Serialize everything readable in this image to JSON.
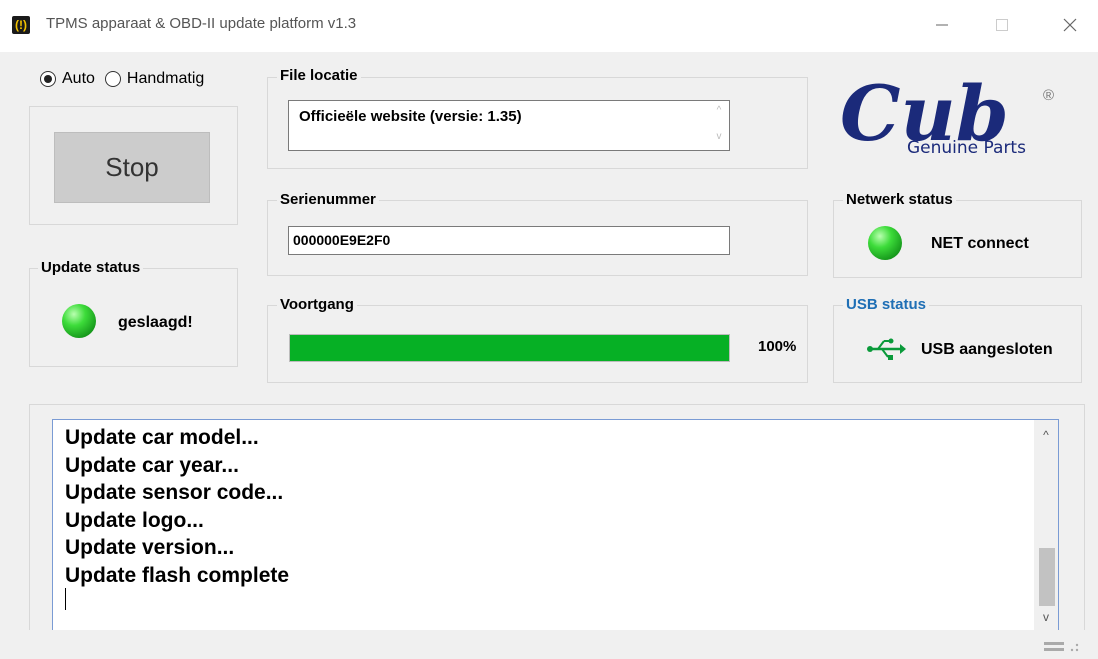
{
  "window": {
    "title": "TPMS apparaat & OBD-II update platform v1.3",
    "icon": "tpms-warning-icon",
    "controls": {
      "minimize": "—",
      "maximize": "☐",
      "close": "✕"
    }
  },
  "mode": {
    "options": [
      "Auto",
      "Handmatig"
    ],
    "selected": "Auto"
  },
  "action_button": {
    "label": "Stop"
  },
  "file_location": {
    "label": "File locatie",
    "value": "Officieële website (versie: 1.35)"
  },
  "serial": {
    "label": "Serienummer",
    "value": "000000E9E2F0"
  },
  "progress": {
    "label": "Voortgang",
    "value_percent": 100,
    "text": "100%",
    "fill_color": "#06b025"
  },
  "update_status": {
    "label": "Update status",
    "text": "geslaagd!",
    "led_color": "green"
  },
  "network_status": {
    "label": "Netwerk status",
    "text": "NET connect",
    "led_color": "green"
  },
  "usb_status": {
    "label": "USB status",
    "text": "USB aangesloten",
    "icon": "usb-icon",
    "label_color": "#1f6fb5"
  },
  "logo": {
    "brand": "Cub",
    "tagline": "Genuine Parts",
    "registered": "®",
    "color": "#1b2a7a"
  },
  "log": {
    "lines": [
      "Update car model...",
      "Update car year...",
      "Update sensor code...",
      "Update logo...",
      "Update version...",
      "Update flash complete"
    ],
    "scroll_up": "^",
    "scroll_down": "v"
  }
}
